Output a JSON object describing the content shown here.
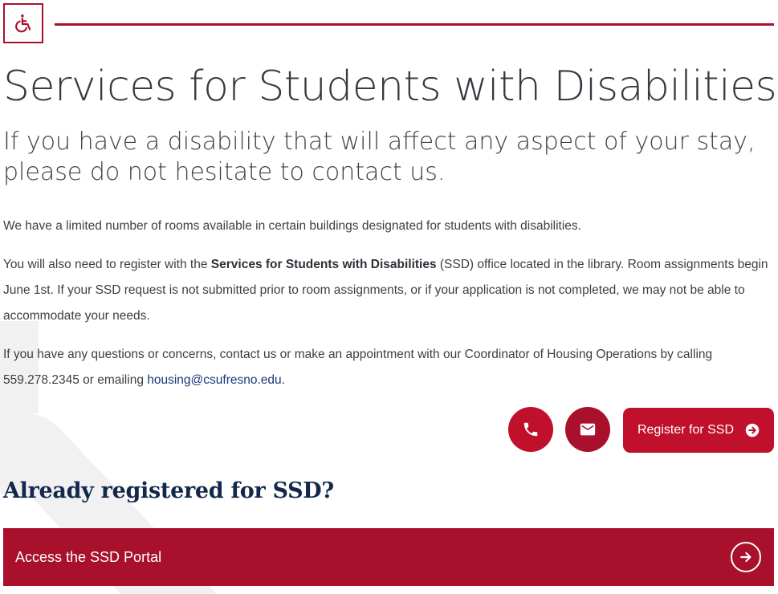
{
  "page": {
    "title": "Services for Students with Disabilities",
    "subtitle": "If you have a disability that will affect any aspect of your stay, please do not hesitate to contact us."
  },
  "icons": {
    "header_icon": "wheelchair-icon",
    "phone": "phone-icon",
    "email": "envelope-icon",
    "register_arrow": "arrow-circle-right-icon",
    "portal_arrow": "arrow-circle-right-icon"
  },
  "content": {
    "p1": "We have a limited number of rooms available in certain buildings designated for students with disabilities.",
    "p2_before": "You will also need to register with the ",
    "p2_bold": "Services for Students with Disabilities",
    "p2_after": " (SSD) office located in the library. Room assignments begin June 1st. If your SSD request is not submitted prior to room assignments, or if your application is not completed, we may not be able to accommodate your needs.",
    "p3_before": "If you have any questions or concerns, contact us or make an appointment with our Coordinator of Housing Operations by calling 559.278.2345 or emailing ",
    "p3_email": "housing@csufresno.edu",
    "p3_after": "."
  },
  "actions": {
    "register_label": "Register for SSD"
  },
  "registered": {
    "heading": "Already registered for SSD?",
    "portal_label": "Access the SSD Portal"
  },
  "colors": {
    "brand_red": "#a8102b",
    "button_red": "#c0102b",
    "heading_navy": "#13294b",
    "link_blue": "#1a3a78"
  }
}
